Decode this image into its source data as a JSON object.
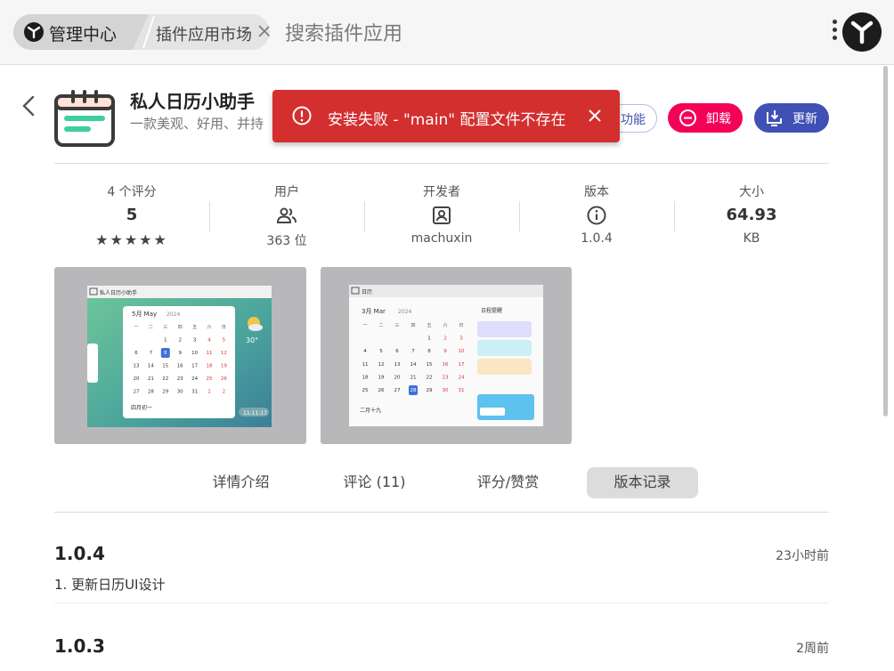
{
  "topbar": {
    "home_label": "管理中心",
    "current_label": "插件应用市场",
    "search_placeholder": "搜索插件应用"
  },
  "app": {
    "title": "私人日历小助手",
    "subtitle": "一款美观、好用、并持"
  },
  "toast": {
    "message": "安装失败 - \"main\" 配置文件不存在",
    "color": "#d32f2f"
  },
  "actions": {
    "function_label": "功能",
    "uninstall_label": "卸载",
    "update_label": "更新",
    "uninstall_color": "#f50057",
    "update_color": "#3f51b5"
  },
  "stats": {
    "rating": {
      "label": "4 个评分",
      "value": "5",
      "stars": "★★★★★",
      "star_count": 5
    },
    "users": {
      "label": "用户",
      "sub": "363 位",
      "icon": "people-icon"
    },
    "developer": {
      "label": "开发者",
      "sub": "machuxin",
      "icon": "person-badge-icon"
    },
    "version": {
      "label": "版本",
      "sub": "1.0.4",
      "icon": "info-icon"
    },
    "size": {
      "label": "大小",
      "value": "64.93",
      "sub": "KB"
    }
  },
  "screenshots": {
    "shot1": {
      "window_title": "私人日历小助手",
      "month": "5月 May",
      "year": "2024",
      "weekdays": [
        "一",
        "二",
        "三",
        "四",
        "五",
        "六",
        "日"
      ],
      "rows": [
        [
          "",
          "",
          "1",
          "2",
          "3",
          "4",
          "5"
        ],
        [
          "6",
          "7",
          "8",
          "9",
          "10",
          "11",
          "12"
        ],
        [
          "13",
          "14",
          "15",
          "16",
          "17",
          "18",
          "19"
        ],
        [
          "20",
          "21",
          "22",
          "23",
          "24",
          "25",
          "26"
        ],
        [
          "27",
          "28",
          "29",
          "30",
          "31",
          "1",
          "2"
        ]
      ],
      "temp": "30°",
      "lunar": "四月初一",
      "clock": "11:11:17"
    },
    "shot2": {
      "window_title": "日历",
      "month": "3月 Mar",
      "year": "2024",
      "weekdays": [
        "一",
        "二",
        "三",
        "四",
        "五",
        "六",
        "日"
      ],
      "rows": [
        [
          "",
          "",
          "",
          "",
          "1",
          "2",
          "3"
        ],
        [
          "4",
          "5",
          "6",
          "7",
          "8",
          "9",
          "10"
        ],
        [
          "11",
          "12",
          "13",
          "14",
          "15",
          "16",
          "17"
        ],
        [
          "18",
          "19",
          "20",
          "21",
          "22",
          "23",
          "24"
        ],
        [
          "25",
          "26",
          "27",
          "28",
          "29",
          "30",
          "31"
        ]
      ],
      "lunar": "二月十九",
      "panel_title": "日程提醒"
    }
  },
  "tabs": [
    "详情介绍",
    "评论 (11)",
    "评分/赞赏",
    "版本记录"
  ],
  "versions": [
    {
      "version": "1.0.4",
      "time": "23小时前",
      "note": "1. 更新日历UI设计"
    },
    {
      "version": "1.0.3",
      "time": "2周前"
    }
  ]
}
